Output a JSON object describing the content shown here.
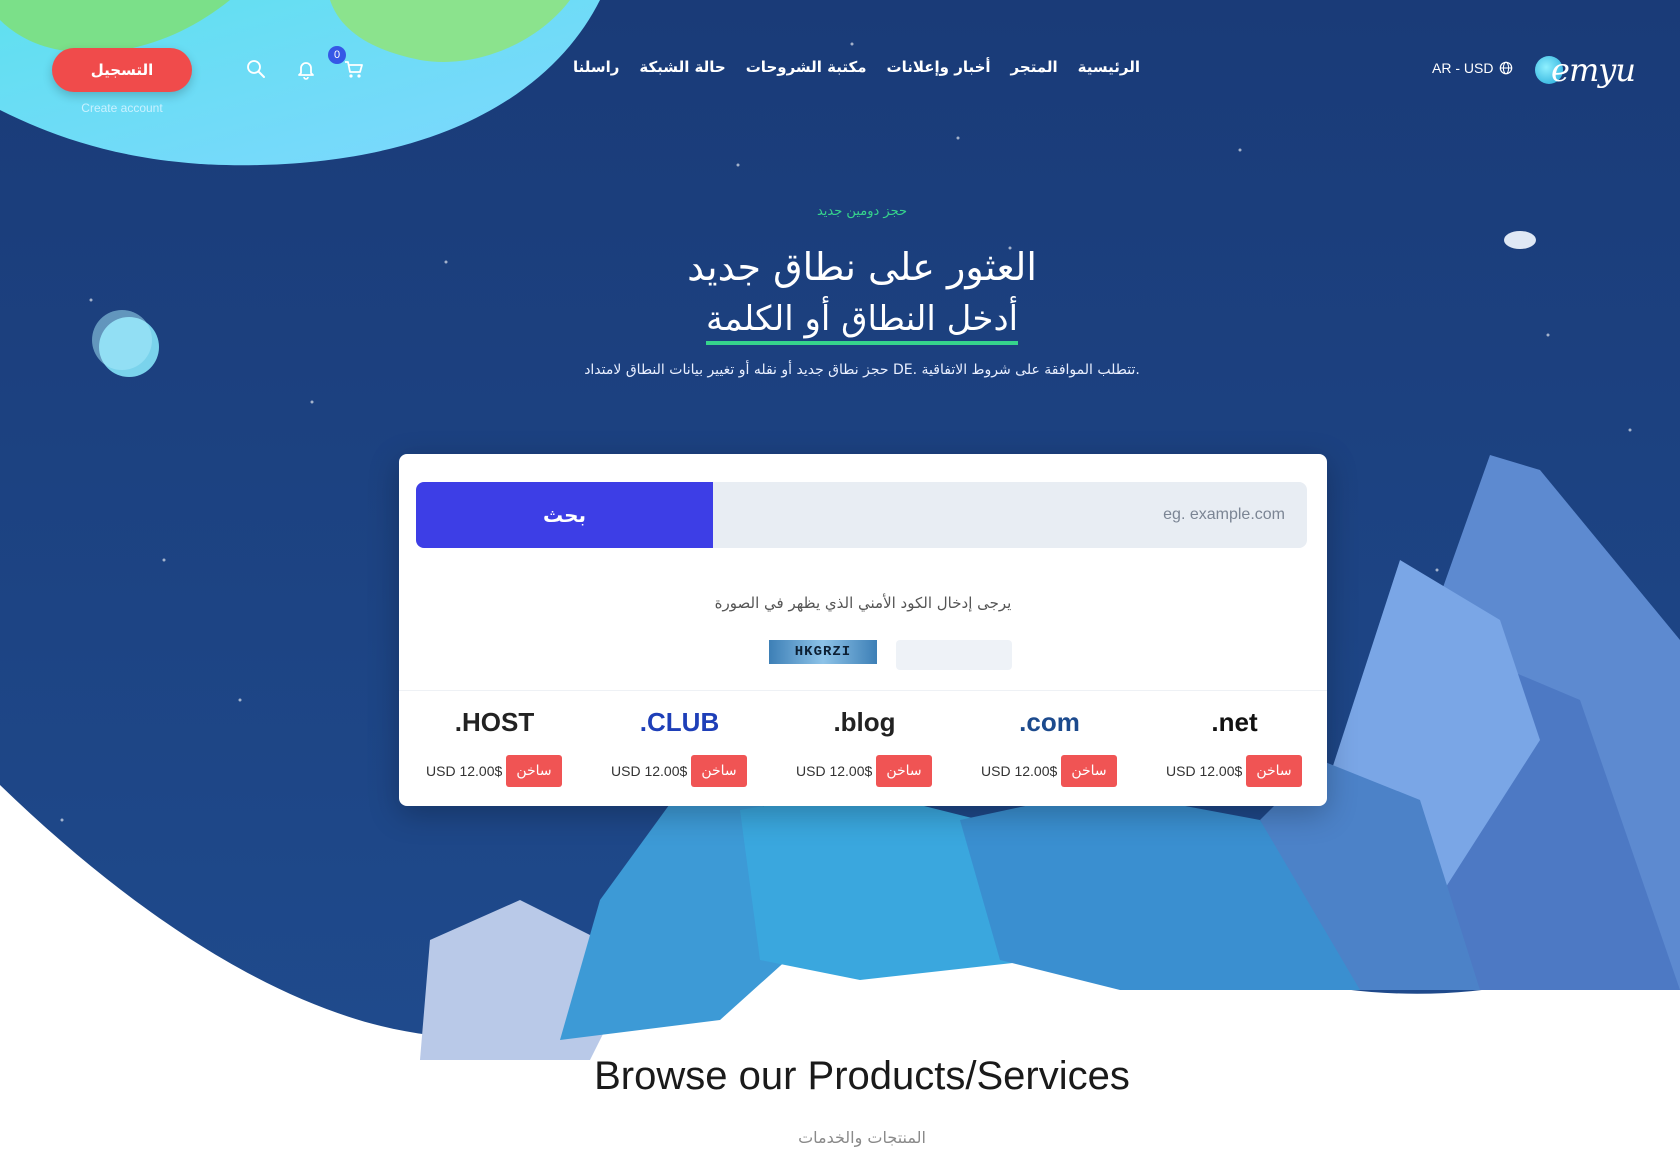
{
  "header": {
    "logo_text": "emyu",
    "lang_currency": "AR - USD",
    "nav": [
      "الرئيسية",
      "المتجر",
      "أخبار وإعلانات",
      "مكتبة الشروحات",
      "حالة الشبكة",
      "راسلنا"
    ],
    "cart_count": "0",
    "register_label": "التسجيل",
    "create_account_label": "Create account"
  },
  "hero": {
    "eyebrow": "حجز دومين جديد",
    "title_line1": "العثور على نطاق جديد",
    "title_line2": "أدخل النطاق أو الكلمة",
    "subtitle": "حجز نطاق جديد أو نقله أو تغيير بيانات النطاق لامتداد DE. تتطلب الموافقة على شروط الاتفاقية."
  },
  "search": {
    "placeholder": "eg. example.com",
    "button_label": "بحث",
    "captcha_label": "يرجى إدخال الكود الأمني الذي يظهر في الصورة",
    "captcha_code": "HKGRZI"
  },
  "tlds": [
    {
      "name": ".net",
      "price": "USD 12.00$",
      "badge": "ساخن"
    },
    {
      "name": ".com",
      "price": "USD 12.00$",
      "badge": "ساخن"
    },
    {
      "name": ".blog",
      "price": "USD 12.00$",
      "badge": "ساخن"
    },
    {
      "name": ".CLUB",
      "price": "USD 12.00$",
      "badge": "ساخن"
    },
    {
      "name": ".HOST",
      "price": "USD 12.00$",
      "badge": "ساخن"
    }
  ],
  "browse": {
    "title": "Browse our Products/Services",
    "subtitle": "المنتجات والخدمات"
  },
  "colors": {
    "hero_bg": "#1d3f7e",
    "accent_red": "#f04b4b",
    "accent_green": "#36d48c",
    "search_button": "#3d3ee6"
  }
}
